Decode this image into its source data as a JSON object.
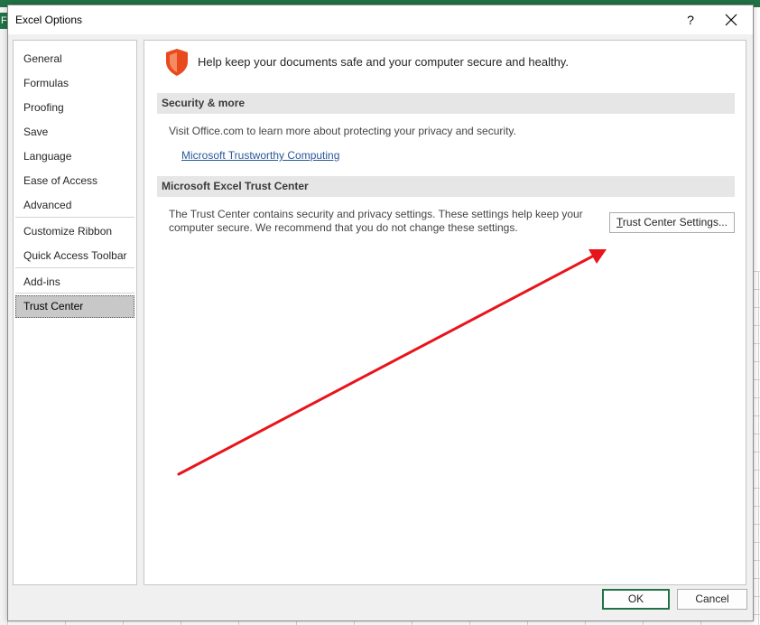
{
  "excel_background": {
    "letter": "F"
  },
  "dialog": {
    "title": "Excel Options",
    "help_glyph": "?",
    "close_icon": "close-icon"
  },
  "sidebar": {
    "items": [
      {
        "label": "General"
      },
      {
        "label": "Formulas"
      },
      {
        "label": "Proofing"
      },
      {
        "label": "Save"
      },
      {
        "label": "Language"
      },
      {
        "label": "Ease of Access"
      },
      {
        "label": "Advanced"
      },
      {
        "label": "Customize Ribbon"
      },
      {
        "label": "Quick Access Toolbar"
      },
      {
        "label": "Add-ins"
      },
      {
        "label": "Trust Center",
        "selected": true
      }
    ]
  },
  "content": {
    "shield_icon": "shield-icon",
    "header": "Help keep your documents safe and your computer secure and healthy.",
    "security_section": {
      "heading": "Security & more",
      "text": "Visit Office.com to learn more about protecting your privacy and security.",
      "link": "Microsoft Trustworthy Computing"
    },
    "trust_section": {
      "heading": "Microsoft Excel Trust Center",
      "text_line1": "The Trust Center contains security and privacy settings. These settings help keep your",
      "text_line2": "computer secure. We recommend that you do not change these settings.",
      "button_accel": "T",
      "button_rest": "rust Center Settings..."
    }
  },
  "footer": {
    "ok_label": "OK",
    "cancel_label": "Cancel"
  },
  "colors": {
    "excel_green": "#217346",
    "link_blue": "#2b579a",
    "shield_orange": "#e8491d",
    "annotation_red": "#e8141b"
  }
}
